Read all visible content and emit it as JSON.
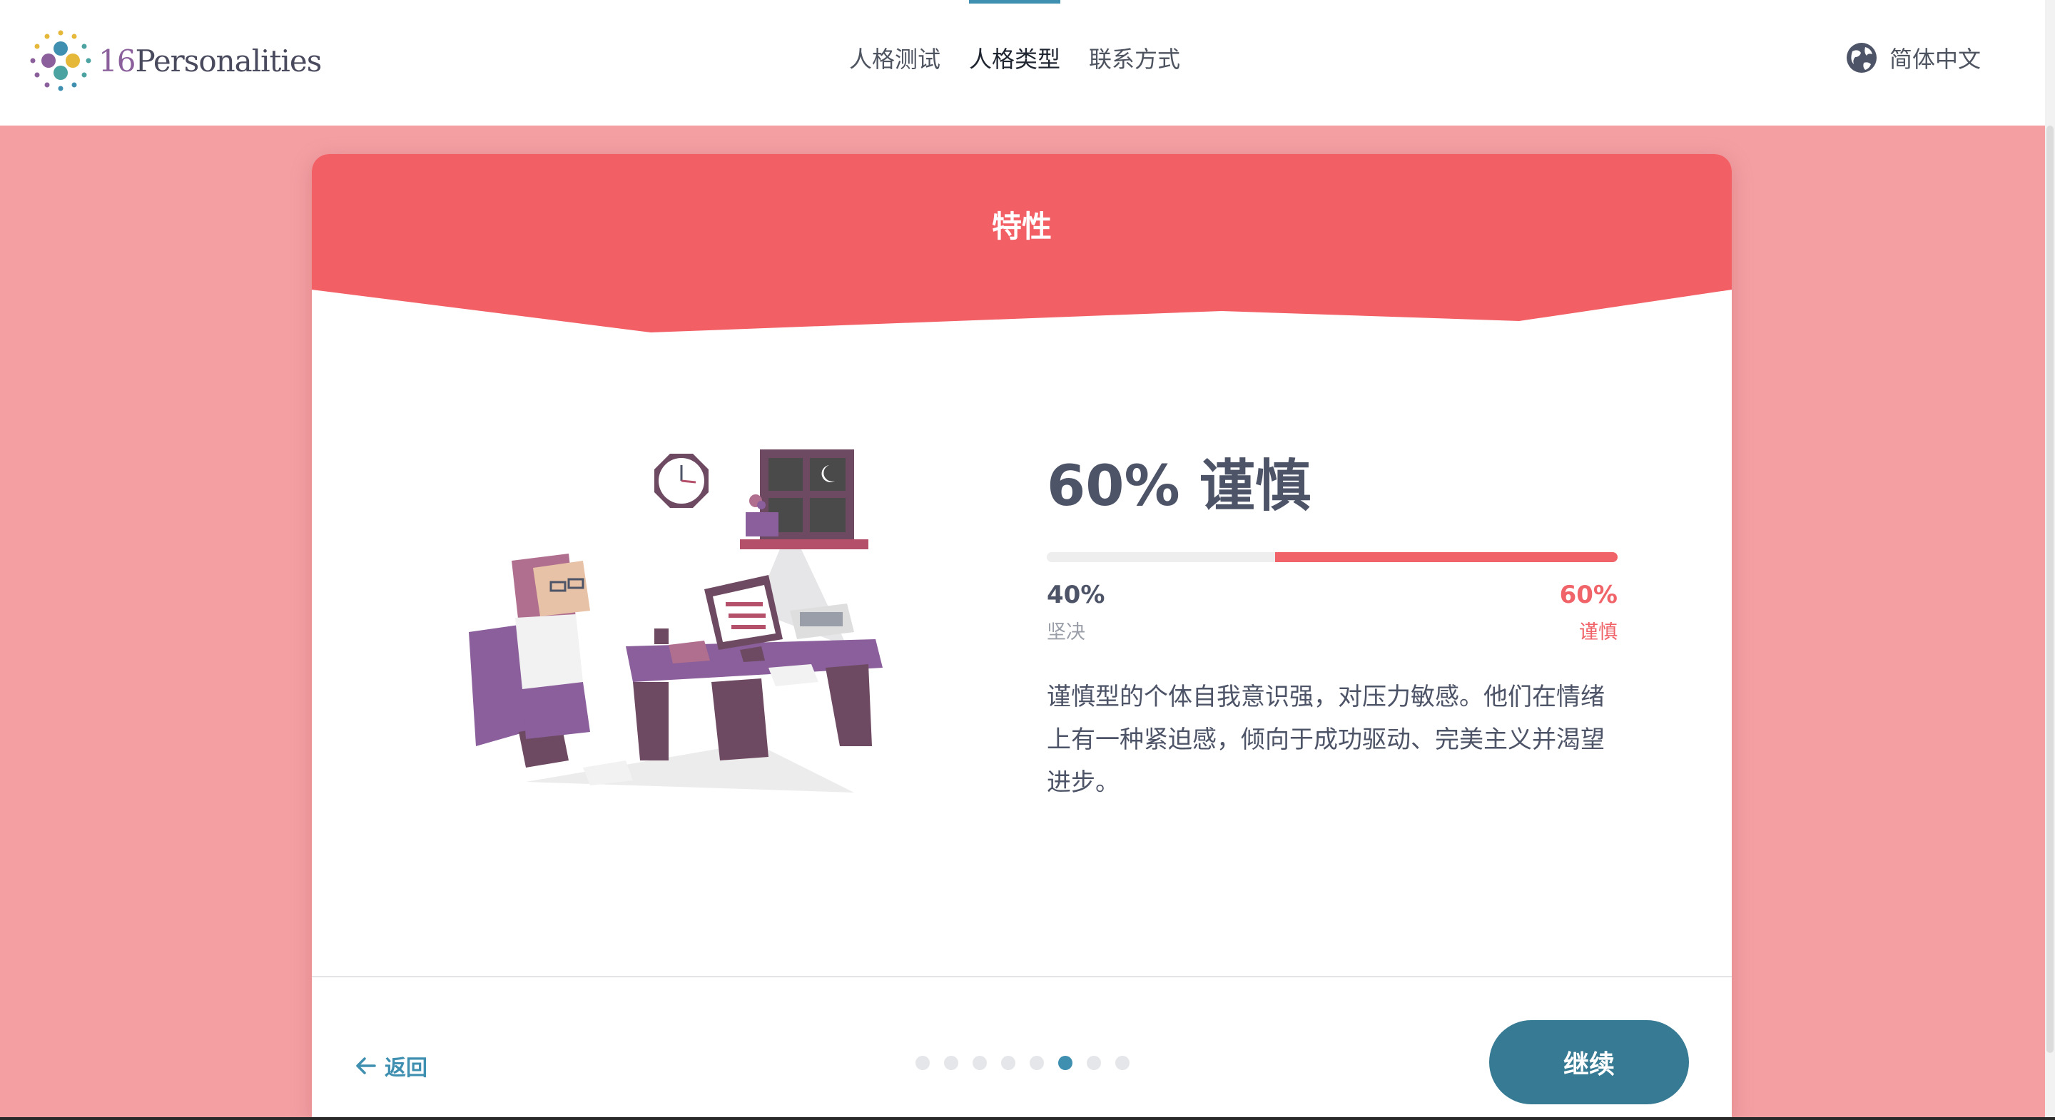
{
  "header": {
    "logo": {
      "number": "16",
      "word": "Personalities"
    },
    "nav": [
      {
        "label": "人格测试",
        "active": false
      },
      {
        "label": "人格类型",
        "active": true
      },
      {
        "label": "联系方式",
        "active": false
      }
    ],
    "language": {
      "label": "简体中文",
      "icon": "globe-icon"
    }
  },
  "card": {
    "title": "特性",
    "illustration": "person-working-at-desk-at-night",
    "trait": {
      "heading": "60% 谨慎",
      "bar_fraction": 0.6,
      "left_percent": "40%",
      "left_label": "坚决",
      "right_percent": "60%",
      "right_label": "谨慎",
      "description": "谨慎型的个体自我意识强，对压力敏感。他们在情绪上有一种紧迫感，倾向于成功驱动、完美主义并渴望进步。"
    },
    "footer": {
      "back_label": "返回",
      "back_icon": "arrow-left-icon",
      "dots_total": 8,
      "dots_active_index": 5,
      "continue_label": "继续"
    }
  },
  "colors": {
    "background": "#f4a0a3",
    "accent_red": "#f06368",
    "accent_blue": "#3f8fb0",
    "button": "#377a93",
    "text_dark": "#4e5467"
  }
}
